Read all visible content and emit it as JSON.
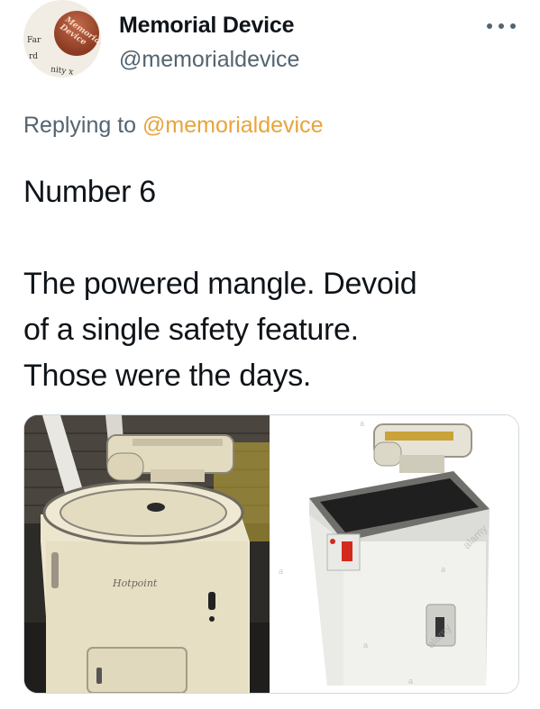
{
  "author": {
    "display_name": "Memorial Device",
    "handle": "@memorialdevice",
    "avatar_icon": "memorial-device-badge-avatar",
    "avatar_text": [
      "Memorial",
      "Device",
      "Far",
      "rd",
      "nity x"
    ]
  },
  "more_icon": "more-options-icon",
  "reply": {
    "prefix": "Replying to",
    "mention": "@memorialdevice"
  },
  "tweet": {
    "lines": [
      "Number 6",
      "The powered mangle. Devoid",
      "of a single safety feature.",
      "Those were the days."
    ]
  },
  "media": {
    "left_image": {
      "description_icon": "photo-icon",
      "brand_text": "Hotpoint"
    },
    "right_image": {
      "description_icon": "photo-icon",
      "watermark_text": [
        "alamy",
        "alamy",
        "a",
        "a",
        "a",
        "a",
        "a"
      ]
    }
  },
  "colors": {
    "text": "#0f1419",
    "secondary": "#536471",
    "mention": "#e8a43a"
  }
}
